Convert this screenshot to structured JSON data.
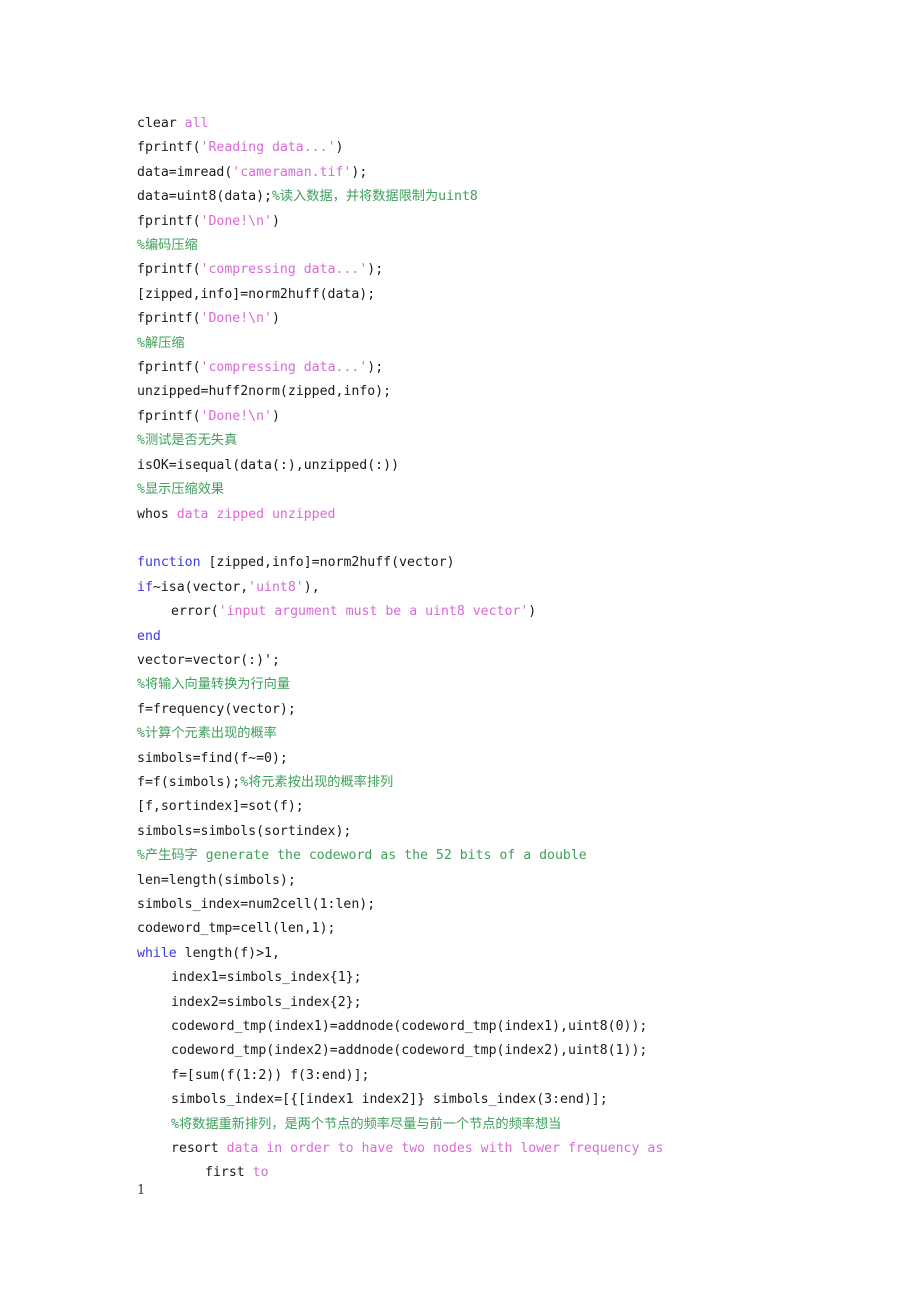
{
  "document": {
    "page_number": "1",
    "colors": {
      "text": "#1a1a1a",
      "keyword": "#3a3ad8",
      "string": "#d96ad9",
      "comment": "#3fa05c",
      "background": "#ffffff"
    },
    "watermark": {
      "line1": "",
      "line2": ""
    }
  },
  "code": {
    "lines": [
      {
        "id": "l1",
        "indent": 0,
        "tokens": [
          {
            "t": "clear ",
            "c": "plain"
          },
          {
            "t": "all",
            "c": "magenta"
          }
        ]
      },
      {
        "id": "l2",
        "indent": 0,
        "tokens": [
          {
            "t": "fprintf(",
            "c": "plain"
          },
          {
            "t": "'Reading data...'",
            "c": "string"
          },
          {
            "t": ")",
            "c": "plain"
          }
        ]
      },
      {
        "id": "l3",
        "indent": 0,
        "tokens": [
          {
            "t": "data=imread(",
            "c": "plain"
          },
          {
            "t": "'cameraman.tif'",
            "c": "string"
          },
          {
            "t": ");",
            "c": "plain"
          }
        ]
      },
      {
        "id": "l4",
        "indent": 0,
        "tokens": [
          {
            "t": "data=uint8(data);",
            "c": "plain"
          },
          {
            "t": "%读入数据，并将数据限制为uint8",
            "c": "comment"
          }
        ]
      },
      {
        "id": "l5",
        "indent": 0,
        "tokens": [
          {
            "t": "fprintf(",
            "c": "plain"
          },
          {
            "t": "'Done!\\n'",
            "c": "string"
          },
          {
            "t": ")",
            "c": "plain"
          }
        ]
      },
      {
        "id": "l6",
        "indent": 0,
        "tokens": [
          {
            "t": "%编码压缩",
            "c": "comment"
          }
        ]
      },
      {
        "id": "l7",
        "indent": 0,
        "tokens": [
          {
            "t": "fprintf(",
            "c": "plain"
          },
          {
            "t": "'compressing data...'",
            "c": "string"
          },
          {
            "t": ");",
            "c": "plain"
          }
        ]
      },
      {
        "id": "l8",
        "indent": 0,
        "tokens": [
          {
            "t": "[zipped,info]=norm2huff(data);",
            "c": "plain"
          }
        ]
      },
      {
        "id": "l9",
        "indent": 0,
        "tokens": [
          {
            "t": "fprintf(",
            "c": "plain"
          },
          {
            "t": "'Done!\\n'",
            "c": "string"
          },
          {
            "t": ")",
            "c": "plain"
          }
        ]
      },
      {
        "id": "l10",
        "indent": 0,
        "tokens": [
          {
            "t": "%解压缩",
            "c": "comment"
          }
        ]
      },
      {
        "id": "l11",
        "indent": 0,
        "tokens": [
          {
            "t": "fprintf(",
            "c": "plain"
          },
          {
            "t": "'compressing data...'",
            "c": "string"
          },
          {
            "t": ");",
            "c": "plain"
          }
        ]
      },
      {
        "id": "l12",
        "indent": 0,
        "tokens": [
          {
            "t": "unzipped=huff2norm(zipped,info);",
            "c": "plain"
          }
        ]
      },
      {
        "id": "l13",
        "indent": 0,
        "tokens": [
          {
            "t": "fprintf(",
            "c": "plain"
          },
          {
            "t": "'Done!\\n'",
            "c": "string"
          },
          {
            "t": ")",
            "c": "plain"
          }
        ]
      },
      {
        "id": "l14",
        "indent": 0,
        "tokens": [
          {
            "t": "%测试是否无失真",
            "c": "comment"
          }
        ]
      },
      {
        "id": "l15",
        "indent": 0,
        "tokens": [
          {
            "t": "isOK=isequal(data(:),unzipped(:))",
            "c": "plain"
          }
        ]
      },
      {
        "id": "l16",
        "indent": 0,
        "tokens": [
          {
            "t": "%显示压缩效果",
            "c": "comment"
          }
        ]
      },
      {
        "id": "l17",
        "indent": 0,
        "tokens": [
          {
            "t": "whos ",
            "c": "plain"
          },
          {
            "t": "data zipped unzipped",
            "c": "magenta"
          }
        ]
      },
      {
        "id": "l18",
        "indent": 0,
        "blank": true,
        "tokens": []
      },
      {
        "id": "l19",
        "indent": 0,
        "tokens": [
          {
            "t": "function",
            "c": "keyword"
          },
          {
            "t": " [zipped,info]=norm2huff(vector)",
            "c": "plain"
          }
        ]
      },
      {
        "id": "l20",
        "indent": 0,
        "tokens": [
          {
            "t": "if",
            "c": "keyword"
          },
          {
            "t": "~isa(vector,",
            "c": "plain"
          },
          {
            "t": "'uint8'",
            "c": "string"
          },
          {
            "t": "),",
            "c": "plain"
          }
        ]
      },
      {
        "id": "l21",
        "indent": 1,
        "tokens": [
          {
            "t": "error(",
            "c": "plain"
          },
          {
            "t": "'input argument must be a uint8 vector'",
            "c": "string"
          },
          {
            "t": ")",
            "c": "plain"
          }
        ]
      },
      {
        "id": "l22",
        "indent": 0,
        "tokens": [
          {
            "t": "end",
            "c": "keyword"
          }
        ]
      },
      {
        "id": "l23",
        "indent": 0,
        "tokens": [
          {
            "t": "vector=vector(:)';",
            "c": "plain"
          }
        ]
      },
      {
        "id": "l24",
        "indent": 0,
        "tokens": [
          {
            "t": "%将输入向量转换为行向量",
            "c": "comment"
          }
        ]
      },
      {
        "id": "l25",
        "indent": 0,
        "tokens": [
          {
            "t": "f=frequency(vector);",
            "c": "plain"
          }
        ]
      },
      {
        "id": "l26",
        "indent": 0,
        "tokens": [
          {
            "t": "%计算个元素出现的概率",
            "c": "comment"
          }
        ]
      },
      {
        "id": "l27",
        "indent": 0,
        "tokens": [
          {
            "t": "simbols=find(f~=0);",
            "c": "plain"
          }
        ]
      },
      {
        "id": "l28",
        "indent": 0,
        "tokens": [
          {
            "t": "f=f(simbols);",
            "c": "plain"
          },
          {
            "t": "%将元素按出现的概率排列",
            "c": "comment"
          }
        ]
      },
      {
        "id": "l29",
        "indent": 0,
        "tokens": [
          {
            "t": "[f,sortindex]=sot(f);",
            "c": "plain"
          }
        ]
      },
      {
        "id": "l30",
        "indent": 0,
        "tokens": [
          {
            "t": "simbols=simbols(sortindex);",
            "c": "plain"
          }
        ]
      },
      {
        "id": "l31",
        "indent": 0,
        "tokens": [
          {
            "t": "%产生码字",
            "c": "comment"
          },
          {
            "t": " generate the codeword as the 52 bits of a double",
            "c": "comment"
          }
        ]
      },
      {
        "id": "l32",
        "indent": 0,
        "tokens": [
          {
            "t": "len=length(simbols);",
            "c": "plain"
          }
        ]
      },
      {
        "id": "l33",
        "indent": 0,
        "tokens": [
          {
            "t": "simbols_index=num2cell(1:len);",
            "c": "plain"
          }
        ]
      },
      {
        "id": "l34",
        "indent": 0,
        "tokens": [
          {
            "t": "codeword_tmp=cell(len,1);",
            "c": "plain"
          }
        ]
      },
      {
        "id": "l35",
        "indent": 0,
        "tokens": [
          {
            "t": "while",
            "c": "keyword"
          },
          {
            "t": " length(f)>1,",
            "c": "plain"
          }
        ]
      },
      {
        "id": "l36",
        "indent": 1,
        "tokens": [
          {
            "t": "index1=simbols_index{1};",
            "c": "plain"
          }
        ]
      },
      {
        "id": "l37",
        "indent": 1,
        "tokens": [
          {
            "t": "index2=simbols_index{2};",
            "c": "plain"
          }
        ]
      },
      {
        "id": "l38",
        "indent": 1,
        "tokens": [
          {
            "t": "codeword_tmp(index1)=addnode(codeword_tmp(index1),uint8(0));",
            "c": "plain"
          }
        ]
      },
      {
        "id": "l39",
        "indent": 1,
        "tokens": [
          {
            "t": "codeword_tmp(index2)=addnode(codeword_tmp(index2),uint8(1));",
            "c": "plain"
          }
        ]
      },
      {
        "id": "l40",
        "indent": 1,
        "tokens": [
          {
            "t": "f=[sum(f(1:2)) f(3:end)];",
            "c": "plain"
          }
        ]
      },
      {
        "id": "l41",
        "indent": 1,
        "tokens": [
          {
            "t": "simbols_index=[{[index1 index2]} simbols_index(3:end)];",
            "c": "plain"
          }
        ]
      },
      {
        "id": "l42",
        "indent": 1,
        "tokens": [
          {
            "t": "%将数据重新排列，是两个节点的频率尽量与前一个节点的频率想当",
            "c": "comment"
          }
        ]
      },
      {
        "id": "l43",
        "indent": 1,
        "tokens": [
          {
            "t": "resort ",
            "c": "plain"
          },
          {
            "t": "data in order to have two nodes with lower frequency as",
            "c": "magenta"
          }
        ]
      },
      {
        "id": "l44",
        "indent": 2,
        "tokens": [
          {
            "t": "first ",
            "c": "plain"
          },
          {
            "t": "to",
            "c": "magenta"
          }
        ]
      }
    ]
  }
}
